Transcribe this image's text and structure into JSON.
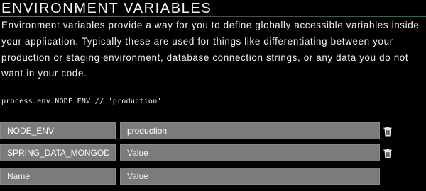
{
  "section": {
    "title": "ENVIRONMENT VARIABLES",
    "description": "Environment variables provide a way for you to define globally accessible variables inside your application. Typically these are used for things like differentiating between your production or staging environment, database connection strings, or any data you do not want in your code.",
    "code_example": "process.env.NODE_ENV // 'production'"
  },
  "env_vars": [
    {
      "key": "NODE_ENV",
      "value": "production",
      "value_placeholder": "Value",
      "delete_icon": "trash-icon"
    },
    {
      "key": "SPRING_DATA_MONGODB",
      "value": "",
      "value_placeholder": "Value",
      "delete_icon": "trash-icon"
    }
  ],
  "new_var": {
    "key_placeholder": "Name",
    "value_placeholder": "Value"
  }
}
